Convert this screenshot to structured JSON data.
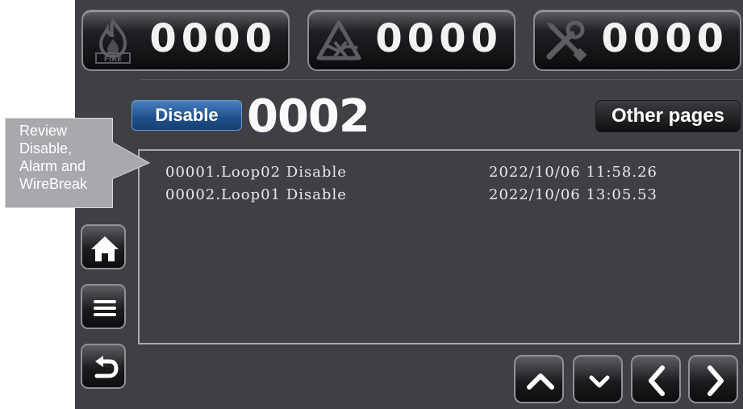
{
  "counters": {
    "fire": {
      "icon": "fire-icon",
      "icon_text": "FIRE",
      "value": "0000"
    },
    "alarm": {
      "icon": "warning-triangle-icon",
      "value": "0000"
    },
    "fault": {
      "icon": "wrench-screwdriver-icon",
      "value": "0000"
    }
  },
  "header": {
    "category_label": "Disable",
    "count": "0002",
    "other_pages_label": "Other pages"
  },
  "records": [
    {
      "entry": "00001.Loop02 Disable",
      "timestamp": "2022/10/06 11:58.26"
    },
    {
      "entry": "00002.Loop01 Disable",
      "timestamp": "2022/10/06 13:05.53"
    }
  ],
  "side_buttons": [
    {
      "icon": "home-icon"
    },
    {
      "icon": "menu-icon"
    },
    {
      "icon": "back-icon"
    }
  ],
  "nav_buttons": [
    {
      "icon": "chevron-up-icon"
    },
    {
      "icon": "chevron-down-icon"
    },
    {
      "icon": "chevron-left-icon"
    },
    {
      "icon": "chevron-right-icon"
    }
  ],
  "callout": {
    "lines": [
      "Review",
      "Disable,",
      "Alarm and",
      "WireBreak"
    ]
  },
  "colors": {
    "screen_bg": "#3e4045",
    "disable_blue": "#1d4f8c",
    "callout_gray": "#a7a9ac"
  }
}
